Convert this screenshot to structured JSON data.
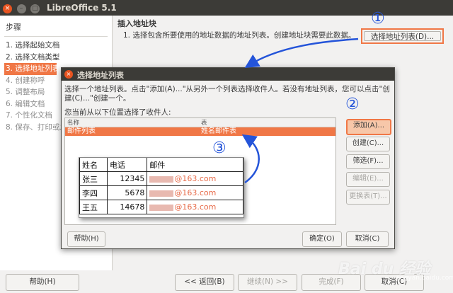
{
  "app": {
    "title": "LibreOffice 5.1"
  },
  "window_controls": {
    "close": "×",
    "minimize": "–",
    "maximize": "□"
  },
  "steps_panel": {
    "heading": "步骤",
    "items": [
      {
        "label": "1. 选择起始文档",
        "state": "done"
      },
      {
        "label": "2. 选择文档类型",
        "state": "done"
      },
      {
        "label": "3. 选择地址列表",
        "state": "selected"
      },
      {
        "label": "4. 创建称呼",
        "state": "dim"
      },
      {
        "label": "5. 调整布局",
        "state": "dim"
      },
      {
        "label": "6. 编辑文档",
        "state": "dim"
      },
      {
        "label": "7. 个性化文档",
        "state": "dim"
      },
      {
        "label": "8. 保存、打印或发",
        "state": "dim"
      }
    ]
  },
  "content": {
    "title": "插入地址块",
    "desc": "1.   选择包含所要使用的地址数据的地址列表。创建地址块需要此数据。",
    "select_source_button": "选择地址列表(D)..."
  },
  "dialog": {
    "title": "选择地址列表",
    "intro": "选择一个地址列表。点击\"添加(A)...\"从另外一个列表选择收件人。若没有地址列表，您可以点击\"创建(C)...\"创建一个。",
    "current_label": "您当前从以下位置选择了收件人:",
    "list": {
      "col_name": "名称",
      "col_table": "表",
      "rows": [
        {
          "name": "邮件列表",
          "table": "姓名邮件表"
        }
      ]
    },
    "buttons": {
      "add": "添加(A)...",
      "create": "创建(C)...",
      "filter": "筛选(F)...",
      "edit": "编辑(E)...",
      "change_table": "更换表(T)...",
      "help": "帮助(H)",
      "ok": "确定(O)",
      "cancel": "取消(C)"
    }
  },
  "footer": {
    "help": "帮助(H)",
    "back": "<< 返回(B)",
    "next": "继续(N) >>",
    "finish": "完成(F)",
    "cancel": "取消(C)"
  },
  "annotations": {
    "n1": "①",
    "n2": "②",
    "n3": "③",
    "color": "#2454d9"
  },
  "spreadsheet": {
    "headers": [
      "姓名",
      "电话",
      "邮件"
    ],
    "rows": [
      {
        "name": "张三",
        "phone": "12345",
        "mail": "@163.com"
      },
      {
        "name": "李四",
        "phone": "5678",
        "mail": "@163.com"
      },
      {
        "name": "王五",
        "phone": "14678",
        "mail": "@163.com"
      }
    ]
  },
  "watermark": {
    "text": "Bai du 经验",
    "sub": "jingyan.baidu.com"
  },
  "colors": {
    "accent": "#f07746",
    "titlebar": "#3c3b37",
    "close": "#e95420"
  }
}
